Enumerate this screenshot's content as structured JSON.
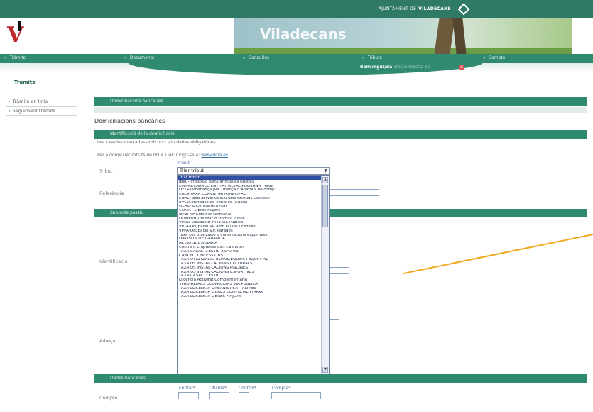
{
  "header": {
    "ayuntament_prefix": "AJUNTAMENT DE",
    "ayuntament_name": "VILADECANS",
    "logo_text": "V",
    "banner_title": "Viladecans"
  },
  "nav": {
    "items": [
      "Tràmits",
      "Documents",
      "Consultes",
      "Tributs",
      "Compte"
    ]
  },
  "user": {
    "label": "Benvingut/da",
    "link": "Desconnectar-se",
    "logout_glyph": "x"
  },
  "breadcrumb": "Tràmits",
  "sidebar": {
    "items": [
      "Tràmits en línia",
      "Seguiment tràmits"
    ]
  },
  "main": {
    "section_bar": "Domiciliacions bancàries",
    "section_title": "Domiciliacions bancàries",
    "id_bar": "Identificació de la domiciliació",
    "note_required": "Les caselles marcades amb un * són dades obligatòries",
    "note_ivtm_prefix": "Per a domiciliar rebuts de IVTM i IAE dirigir-se a:",
    "note_ivtm_link": "www.diba.es",
    "label_tribut": "Tribut",
    "tiny_tribut": "Tribut",
    "label_referencia": "Referència",
    "subj_bar": "Subjecte passiu",
    "label_identificacio": "Identificació",
    "label_adreca": "Adreça",
    "bank_bar": "Dades bancàries",
    "label_compte": "Compte",
    "bank_fields": [
      "Entitat*",
      "Oficina*",
      "Control*",
      "Compte*"
    ]
  },
  "select": {
    "value": "Triar tribut",
    "arrow": "▼",
    "scroll_up": "▲",
    "scroll_down": "▼",
    "options": [
      "Triar tribut",
      "IBIR - Impost/o Béns Immobles Rústica",
      "EMT-RECÀRREC ENTITAT METROPOLITANA TRAN",
      "OFTA-Ordenança per Tinença d'Animals de comp",
      "CRCV-TAXA CEMENTIRI MUNICIPAL",
      "EGRC-Taxa Servei Gestió dels Residus Comerci",
      "EVCD-Entrades de Vehicles (Guals)",
      "OEAC- Llicència Activitat",
      "COMA - Obres Majors",
      "MERCSET-Mercat setmanal",
      "DOMPUB-Utilització Domini Públic",
      "VPOO-Ocupació en la via Pública",
      "VPTA-Ocupació VP amb taules i cadires",
      "VPPA-Ocupació V.P. Parades",
      "Taxa per utilització d'instal·lacions esportives",
      "DIPOSITS DE GARANTIA",
      "ACCIO SUBSIDIÀRIA",
      "Centre d'Empreses Can Calderon",
      "TAXA CASAL D'ESTIU ESPORTS",
      "CANON CONCESSIONS",
      "TAXA UTILITZACIÓ ESPAIS,EQUIPS I EQUIP. ML",
      "TAXA US INSTAL·LACIONS CULTURALS",
      "TAXA US INSTAL·LACIONS PISCINES",
      "TAXA US INSTAL·LACIONS ESPORTIVES",
      "TAXA CASAL D'ESTIU",
      "Llicència Activitat Complementària",
      "VPAO-ALTRES OCUPACIONS VIA PUBLICA",
      "TAXA LLICÈNCIA URBANÍSTICA - ALTRES",
      "TAXA LLICÈNCIA OBRES COMPLEMENTÀRIA",
      "TAXA LLICÈNCIA OBRES MAJORS"
    ]
  },
  "colors": {
    "brand_green": "#2f8a70",
    "topbar": "#2f7a66",
    "selected_option": "#2e4fa3",
    "callout": "#f0a81c",
    "logo_red": "#c0282b"
  },
  "icons": {
    "nav_chevron": "»",
    "sidebar_bullet": "›"
  }
}
